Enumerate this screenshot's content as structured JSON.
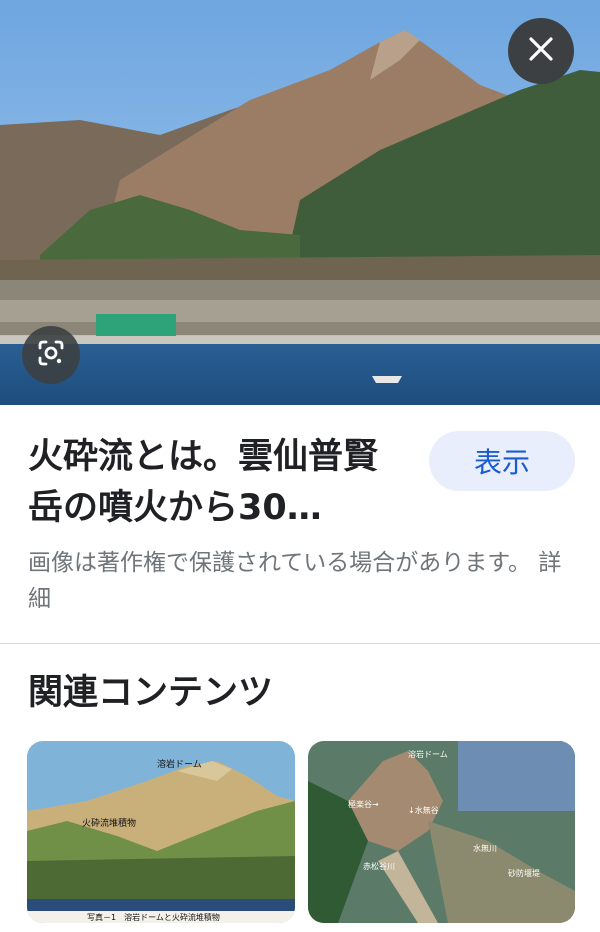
{
  "main": {
    "title": "火砕流とは。雲仙普賢岳の噴火から30…",
    "show_label": "表示",
    "notice": "画像は著作権で保護されている場合があります。 詳細"
  },
  "related": {
    "heading": "関連コンテンツ",
    "thumb1": {
      "label_dome": "溶岩ドーム",
      "label_deposit": "火砕流堆積物",
      "caption": "写真－1　溶岩ドームと火砕流堆積物"
    },
    "thumb2": {
      "label_dome": "溶岩ドーム",
      "label_a": "極楽谷→",
      "label_b": "↓水無谷",
      "label_c": "赤松谷川",
      "label_d": "水無川",
      "label_e": "砂防堰堤"
    }
  },
  "icons": {
    "close": "close-icon",
    "lens": "google-lens-icon"
  },
  "colors": {
    "accent": "#1a5ad3",
    "button_bg": "#e8eefb",
    "overlay_button": "#3c4043"
  }
}
